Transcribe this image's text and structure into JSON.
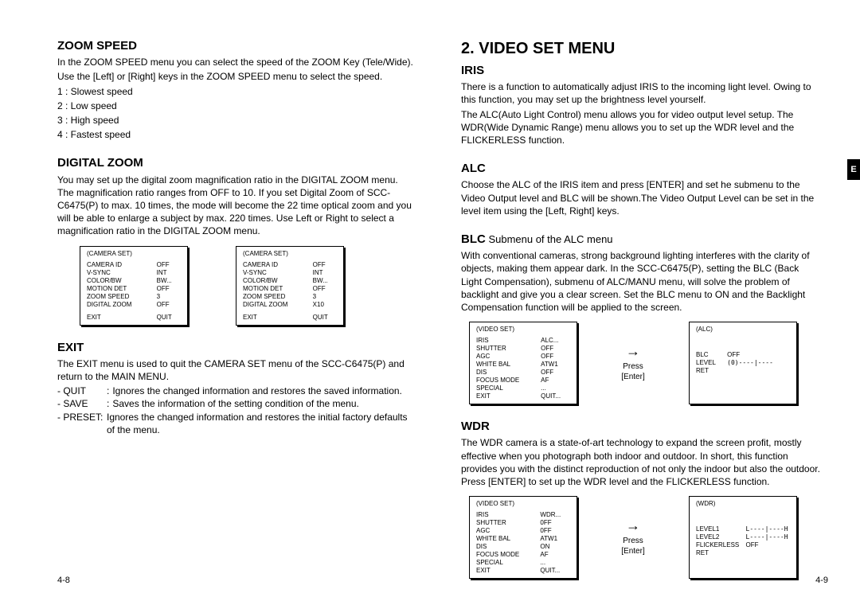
{
  "sideTab": "E",
  "pageLeftNum": "4-8",
  "pageRightNum": "4-9",
  "left": {
    "zoomSpeed": {
      "heading": "ZOOM SPEED",
      "p1": "In the ZOOM SPEED menu you can select the speed of the ZOOM Key (Tele/Wide).",
      "p2": "Use the [Left] or [Right] keys in the ZOOM SPEED menu to select the speed.",
      "l1": "1 : Slowest speed",
      "l2": "2 : Low speed",
      "l3": "3 : High speed",
      "l4": "4 : Fastest speed"
    },
    "digitalZoom": {
      "heading": "DIGITAL ZOOM",
      "p1": "You may set up the digital zoom magnification ratio in the DIGITAL ZOOM menu. The magnification ratio ranges from OFF to 10. If you set Digital Zoom of SCC-C6475(P) to max. 10 times, the mode will become the 22 time optical zoom and you will be able to enlarge a subject by max. 220 times. Use Left or Right to select a magnification ratio in the DIGITAL ZOOM menu."
    },
    "menu1": {
      "title": "(CAMERA SET)",
      "rows": [
        [
          "CAMERA ID",
          "OFF"
        ],
        [
          "V-SYNC",
          "INT"
        ],
        [
          "COLOR/BW",
          "BW..."
        ],
        [
          "MOTION DET",
          "OFF"
        ],
        [
          "ZOOM SPEED",
          "3"
        ],
        [
          "DIGITAL ZOOM",
          "OFF"
        ]
      ],
      "exit": [
        "EXIT",
        "QUIT"
      ]
    },
    "menu2": {
      "title": "(CAMERA SET)",
      "rows": [
        [
          "CAMERA ID",
          "OFF"
        ],
        [
          "V-SYNC",
          "INT"
        ],
        [
          "COLOR/BW",
          "BW..."
        ],
        [
          "MOTION DET",
          "OFF"
        ],
        [
          "ZOOM SPEED",
          "3"
        ],
        [
          "DIGITAL ZOOM",
          "X10"
        ]
      ],
      "exit": [
        "EXIT",
        "QUIT"
      ]
    },
    "exit": {
      "heading": "EXIT",
      "p1": "The EXIT menu is used to quit the CAMERA SET menu of the SCC-C6475(P) and return to the MAIN MENU.",
      "quit_t": "QUIT",
      "quit_d": "Ignores the changed information and restores the saved information.",
      "save_t": "SAVE",
      "save_d": "Saves the information of the setting condition of the menu.",
      "preset_t": "PRESET:",
      "preset_d": "Ignores the changed information and restores the initial factory defaults of the menu."
    }
  },
  "right": {
    "title": "2. VIDEO SET MENU",
    "iris": {
      "heading": "IRIS",
      "p1": "There is a function to automatically adjust IRIS to the incoming light level. Owing to this function, you may set up the brightness level yourself.",
      "p2": "The ALC(Auto Light Control) menu allows you for video output level setup. The WDR(Wide Dynamic Range) menu allows you to set up the WDR level and the FLICKERLESS function."
    },
    "alc": {
      "heading": "ALC",
      "p1": "Choose the ALC of the IRIS item and press [ENTER] and set he submenu to the Video Output level and BLC will be shown.The Video Output Level can be set in the level item using the [Left, Right] keys."
    },
    "blc": {
      "heading": "BLC",
      "sub": " Submenu of the ALC menu",
      "p1": "With conventional cameras, strong background lighting interferes with the clarity of objects, making them appear dark.  In the SCC-C6475(P), setting the BLC (Back Light Compensation), submenu of ALC/MANU menu, will solve the problem of backlight and give you a clear screen. Set the BLC menu to ON and the Backlight Compensation function will be applied to the screen."
    },
    "menuV1": {
      "title": "(VIDEO SET)",
      "rows": [
        [
          "IRIS",
          "ALC..."
        ],
        [
          "SHUTTER",
          "OFF"
        ],
        [
          "AGC",
          "OFF"
        ],
        [
          "WHITE BAL",
          "ATW1"
        ],
        [
          "DIS",
          "OFF"
        ],
        [
          "FOCUS MODE",
          "AF"
        ],
        [
          "SPECIAL",
          "..."
        ],
        [
          "EXIT",
          "QUIT..."
        ]
      ]
    },
    "menuA1": {
      "title": "(ALC)",
      "rows": [
        [
          "BLC",
          "OFF"
        ],
        [
          "LEVEL",
          "(0)----|----"
        ],
        [
          "RET",
          ""
        ]
      ]
    },
    "arrow1": {
      "a": "→",
      "l1": "Press",
      "l2": "[Enter]"
    },
    "wdr": {
      "heading": "WDR",
      "p1": "The WDR camera is a state-of-art technology to expand the screen profit, mostly effective when you photograph both indoor and outdoor. In short, this function provides you with the distinct reproduction of not only the indoor but also the outdoor. Press [ENTER] to set up the WDR level and the FLICKERLESS function."
    },
    "menuV2": {
      "title": "(VIDEO SET)",
      "rows": [
        [
          "IRIS",
          "WDR..."
        ],
        [
          "SHUTTER",
          "0FF"
        ],
        [
          "AGC",
          "0FF"
        ],
        [
          "WHITE BAL",
          "ATW1"
        ],
        [
          "DIS",
          "ON"
        ],
        [
          "FOCUS MODE",
          "AF"
        ],
        [
          "SPECIAL",
          "..."
        ],
        [
          "EXIT",
          "QUIT..."
        ]
      ]
    },
    "menuW1": {
      "title": "(WDR)",
      "rows": [
        [
          "LEVEL1",
          "L----|----H"
        ],
        [
          "LEVEL2",
          "L----|----H"
        ],
        [
          "FLICKERLESS",
          "OFF"
        ],
        [
          "RET",
          ""
        ]
      ]
    },
    "arrow2": {
      "a": "→",
      "l1": "Press",
      "l2": "[Enter]"
    }
  }
}
